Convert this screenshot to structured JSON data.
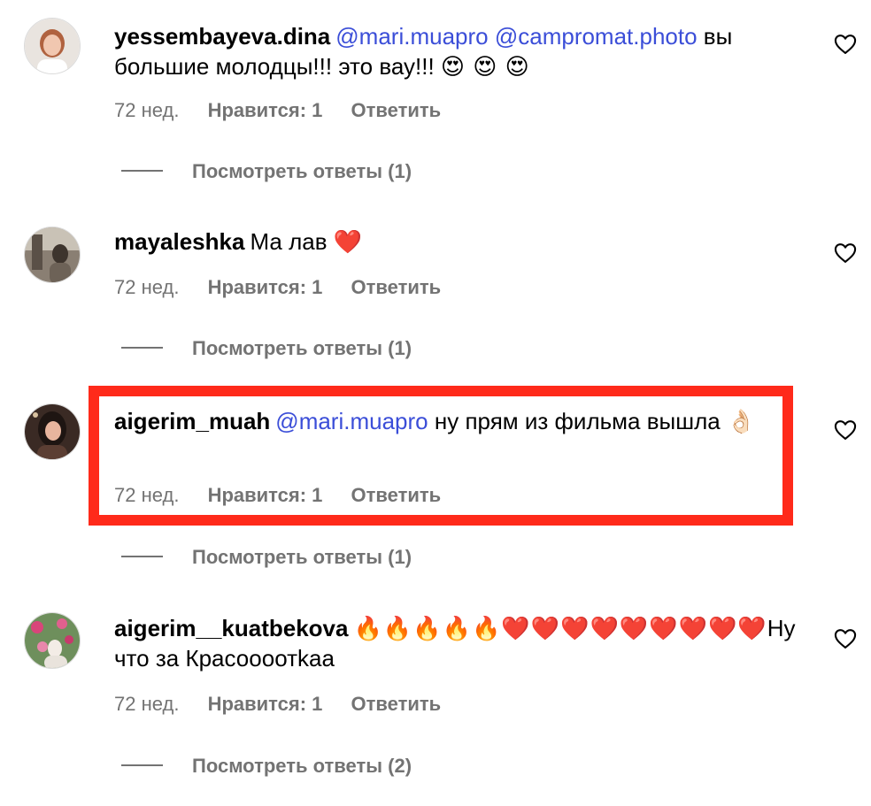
{
  "comments": [
    {
      "username": "yessembayeva.dina",
      "mentions": [
        "@mari.muapro",
        "@campromat.photo"
      ],
      "text": "вы большие молодцы!!! это вау!!!",
      "emoji": "😍 😍 😍",
      "time": "72 нед.",
      "likes": "Нравится: 1",
      "reply": "Ответить",
      "view_replies": "Посмотреть ответы (1)"
    },
    {
      "username": "mayaleshka",
      "mentions": [],
      "text": "Ма лав",
      "emoji": "❤️",
      "time": "72 нед.",
      "likes": "Нравится: 1",
      "reply": "Ответить",
      "view_replies": "Посмотреть ответы (1)"
    },
    {
      "username": "aigerim_muah",
      "mentions": [
        "@mari.muapro"
      ],
      "text": "ну прям из фильма вышла",
      "emoji": "👌🏻",
      "time": "72 нед.",
      "likes": "Нравится: 1",
      "reply": "Ответить",
      "view_replies": "Посмотреть ответы (1)",
      "highlighted": true
    },
    {
      "username": "aigerim__kuatbekova",
      "mentions": [],
      "emoji_lead": "🔥🔥🔥🔥🔥❤️❤️❤️❤️❤️❤️❤️❤️❤️",
      "text": "Ну что за Красоооотkaa",
      "time": "72 нед.",
      "likes": "Нравится: 1",
      "reply": "Ответить",
      "view_replies": "Посмотреть ответы (2)"
    }
  ],
  "colors": {
    "mention": "#3b4ed8",
    "meta": "#737373",
    "highlight_border": "#ff2a1a"
  },
  "icons": {
    "like": "heart-outline-icon"
  }
}
